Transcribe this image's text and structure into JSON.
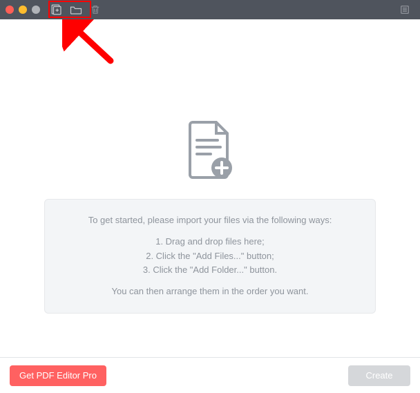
{
  "titlebar": {
    "traffic": {
      "close": "close",
      "minimize": "minimize",
      "zoom": "zoom"
    },
    "buttons": {
      "add_files": "Add Files",
      "add_folder": "Add Folder",
      "trash": "Trash",
      "list": "List View"
    }
  },
  "annotation": {
    "highlight_target": "add-buttons",
    "arrow_color": "#ff0000"
  },
  "main": {
    "placeholder_icon": "document-add",
    "intro": "To get started, please import your files via the following ways:",
    "steps": [
      "1. Drag and drop files here;",
      "2. Click the \"Add Files...\" button;",
      "3. Click the \"Add Folder...\" button."
    ],
    "outro": "You can then arrange them in the order you want."
  },
  "footer": {
    "pro_button": "Get PDF Editor Pro",
    "create_button": "Create"
  }
}
